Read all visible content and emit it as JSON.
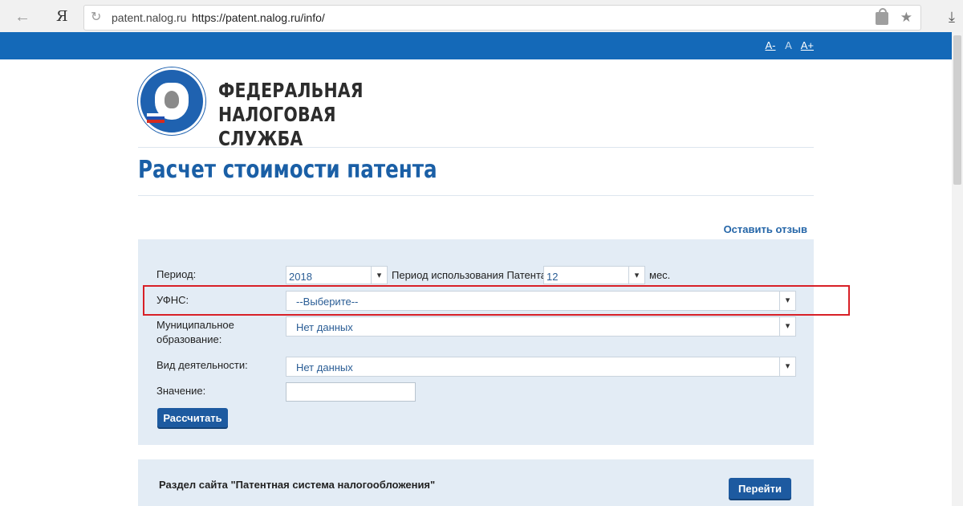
{
  "browser": {
    "back_icon": "arrow-left-icon",
    "yandex_logo": "Я",
    "url_domain": "patent.nalog.ru",
    "url_full": "https://patent.nalog.ru/info/",
    "reload_glyph": "↻",
    "star_glyph": "★",
    "download_glyph": "⤓"
  },
  "header": {
    "font_smaller": "A-",
    "font_normal": "A",
    "font_larger": "A+",
    "org_line1": "ФЕДЕРАЛЬНАЯ",
    "org_line2": "НАЛОГОВАЯ СЛУЖБА"
  },
  "page": {
    "title": "Расчет стоимости патента",
    "feedback_link": "Оставить отзыв"
  },
  "form": {
    "period_label": "Период:",
    "period_value": "2018",
    "usage_label": "Период использования Патента:",
    "usage_value": "12",
    "months_unit": "мес.",
    "ufns_label": "УФНС:",
    "ufns_value": "--Выберите--",
    "municipal_label_1": "Муниципальное",
    "municipal_label_2": "образование:",
    "municipal_value": "Нет данных",
    "activity_label": "Вид деятельности:",
    "activity_value": "Нет данных",
    "value_label": "Значение:",
    "value_input": "",
    "calculate_button": "Рассчитать"
  },
  "bottom": {
    "section_text": "Раздел сайта \"Патентная система налогообложения\"",
    "go_button": "Перейти"
  },
  "colors": {
    "brand_blue": "#1469b8",
    "panel_bg": "#e3ecf5",
    "highlight_red": "#d82027",
    "title_blue": "#1a5fa6"
  }
}
